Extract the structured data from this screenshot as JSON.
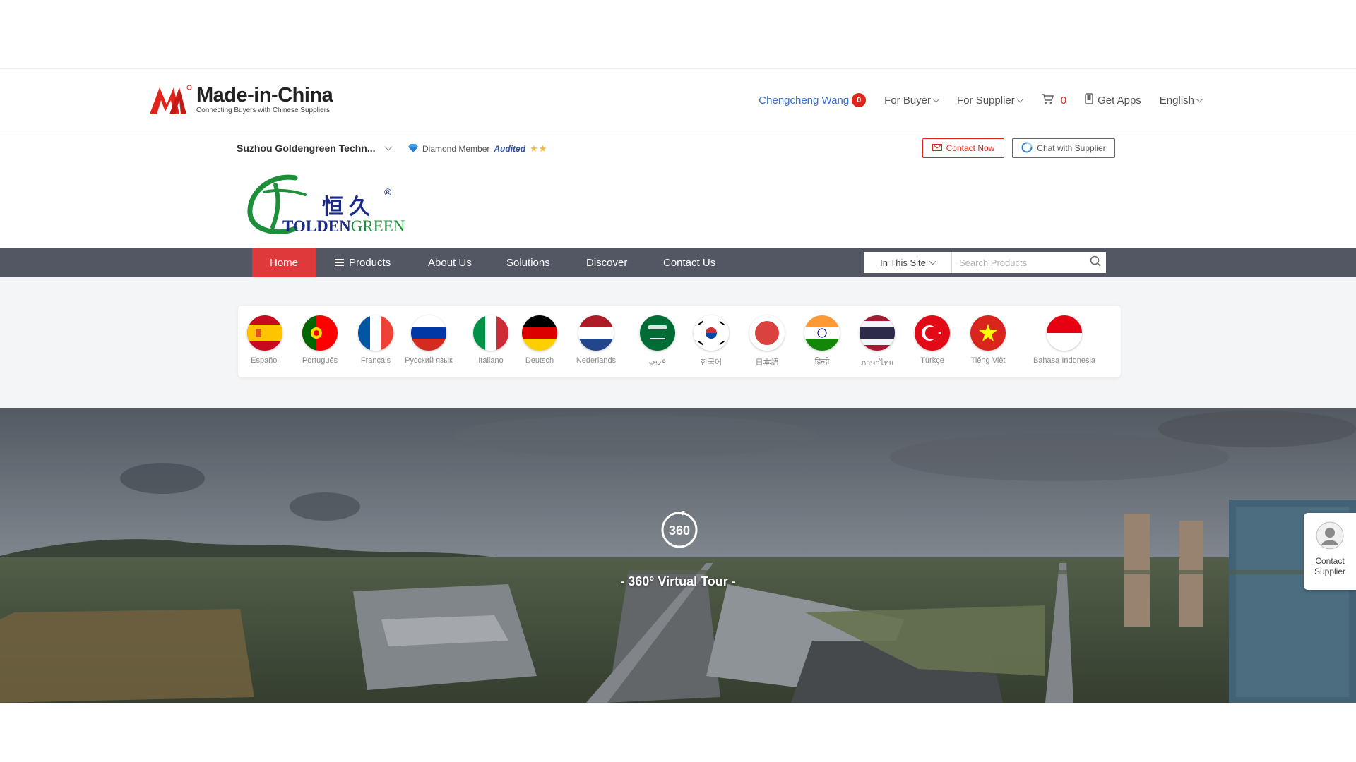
{
  "site": {
    "brand": "Made-in-China",
    "tagline": "Connecting Buyers with Chinese Suppliers"
  },
  "top_nav": {
    "user_name": "Chengcheng Wang",
    "user_badge": "0",
    "for_buyer": "For Buyer",
    "for_supplier": "For Supplier",
    "cart_count": "0",
    "get_apps": "Get Apps",
    "language": "English"
  },
  "supplier": {
    "name": "Suzhou Goldengreen Techn...",
    "membership": "Diamond Member",
    "audited": "Audited",
    "stars": "★★",
    "contact_now": "Contact Now",
    "chat": "Chat with Supplier"
  },
  "company_logo": {
    "chinese": "恒久",
    "reg": "®",
    "english_part1": "TOLDEN",
    "english_part2": "GREEN"
  },
  "main_nav": {
    "items": [
      "Home",
      "Products",
      "About Us",
      "Solutions",
      "Discover",
      "Contact Us"
    ],
    "active": "Home",
    "search_scope": "In This Site",
    "search_placeholder": "Search Products"
  },
  "languages": [
    {
      "label": "Español",
      "flag": "spain"
    },
    {
      "label": "Português",
      "flag": "portugal"
    },
    {
      "label": "Français",
      "flag": "france"
    },
    {
      "label": "Русский язык",
      "flag": "russia"
    },
    {
      "label": "Italiano",
      "flag": "italy"
    },
    {
      "label": "Deutsch",
      "flag": "germany"
    },
    {
      "label": "Nederlands",
      "flag": "netherlands"
    },
    {
      "label": "عربى",
      "flag": "saudi-arabia"
    },
    {
      "label": "한국어",
      "flag": "korea"
    },
    {
      "label": "日本語",
      "flag": "japan"
    },
    {
      "label": "हिन्दी",
      "flag": "india"
    },
    {
      "label": "ภาษาไทย",
      "flag": "thailand"
    },
    {
      "label": "Türkçe",
      "flag": "turkey"
    },
    {
      "label": "Tiếng Việt",
      "flag": "vietnam"
    },
    {
      "label": "Bahasa Indonesia",
      "flag": "indonesia"
    }
  ],
  "panorama": {
    "icon_text": "360",
    "label": "- 360° Virtual Tour -"
  },
  "float_contact": {
    "label": "Contact Supplier"
  },
  "colors": {
    "brand_red": "#e2231a",
    "nav_bg": "#535764",
    "nav_active": "#e0393c",
    "link_blue": "#3a6fd1",
    "logo_green": "#1d8f3a",
    "logo_navy": "#1a2a8a"
  }
}
